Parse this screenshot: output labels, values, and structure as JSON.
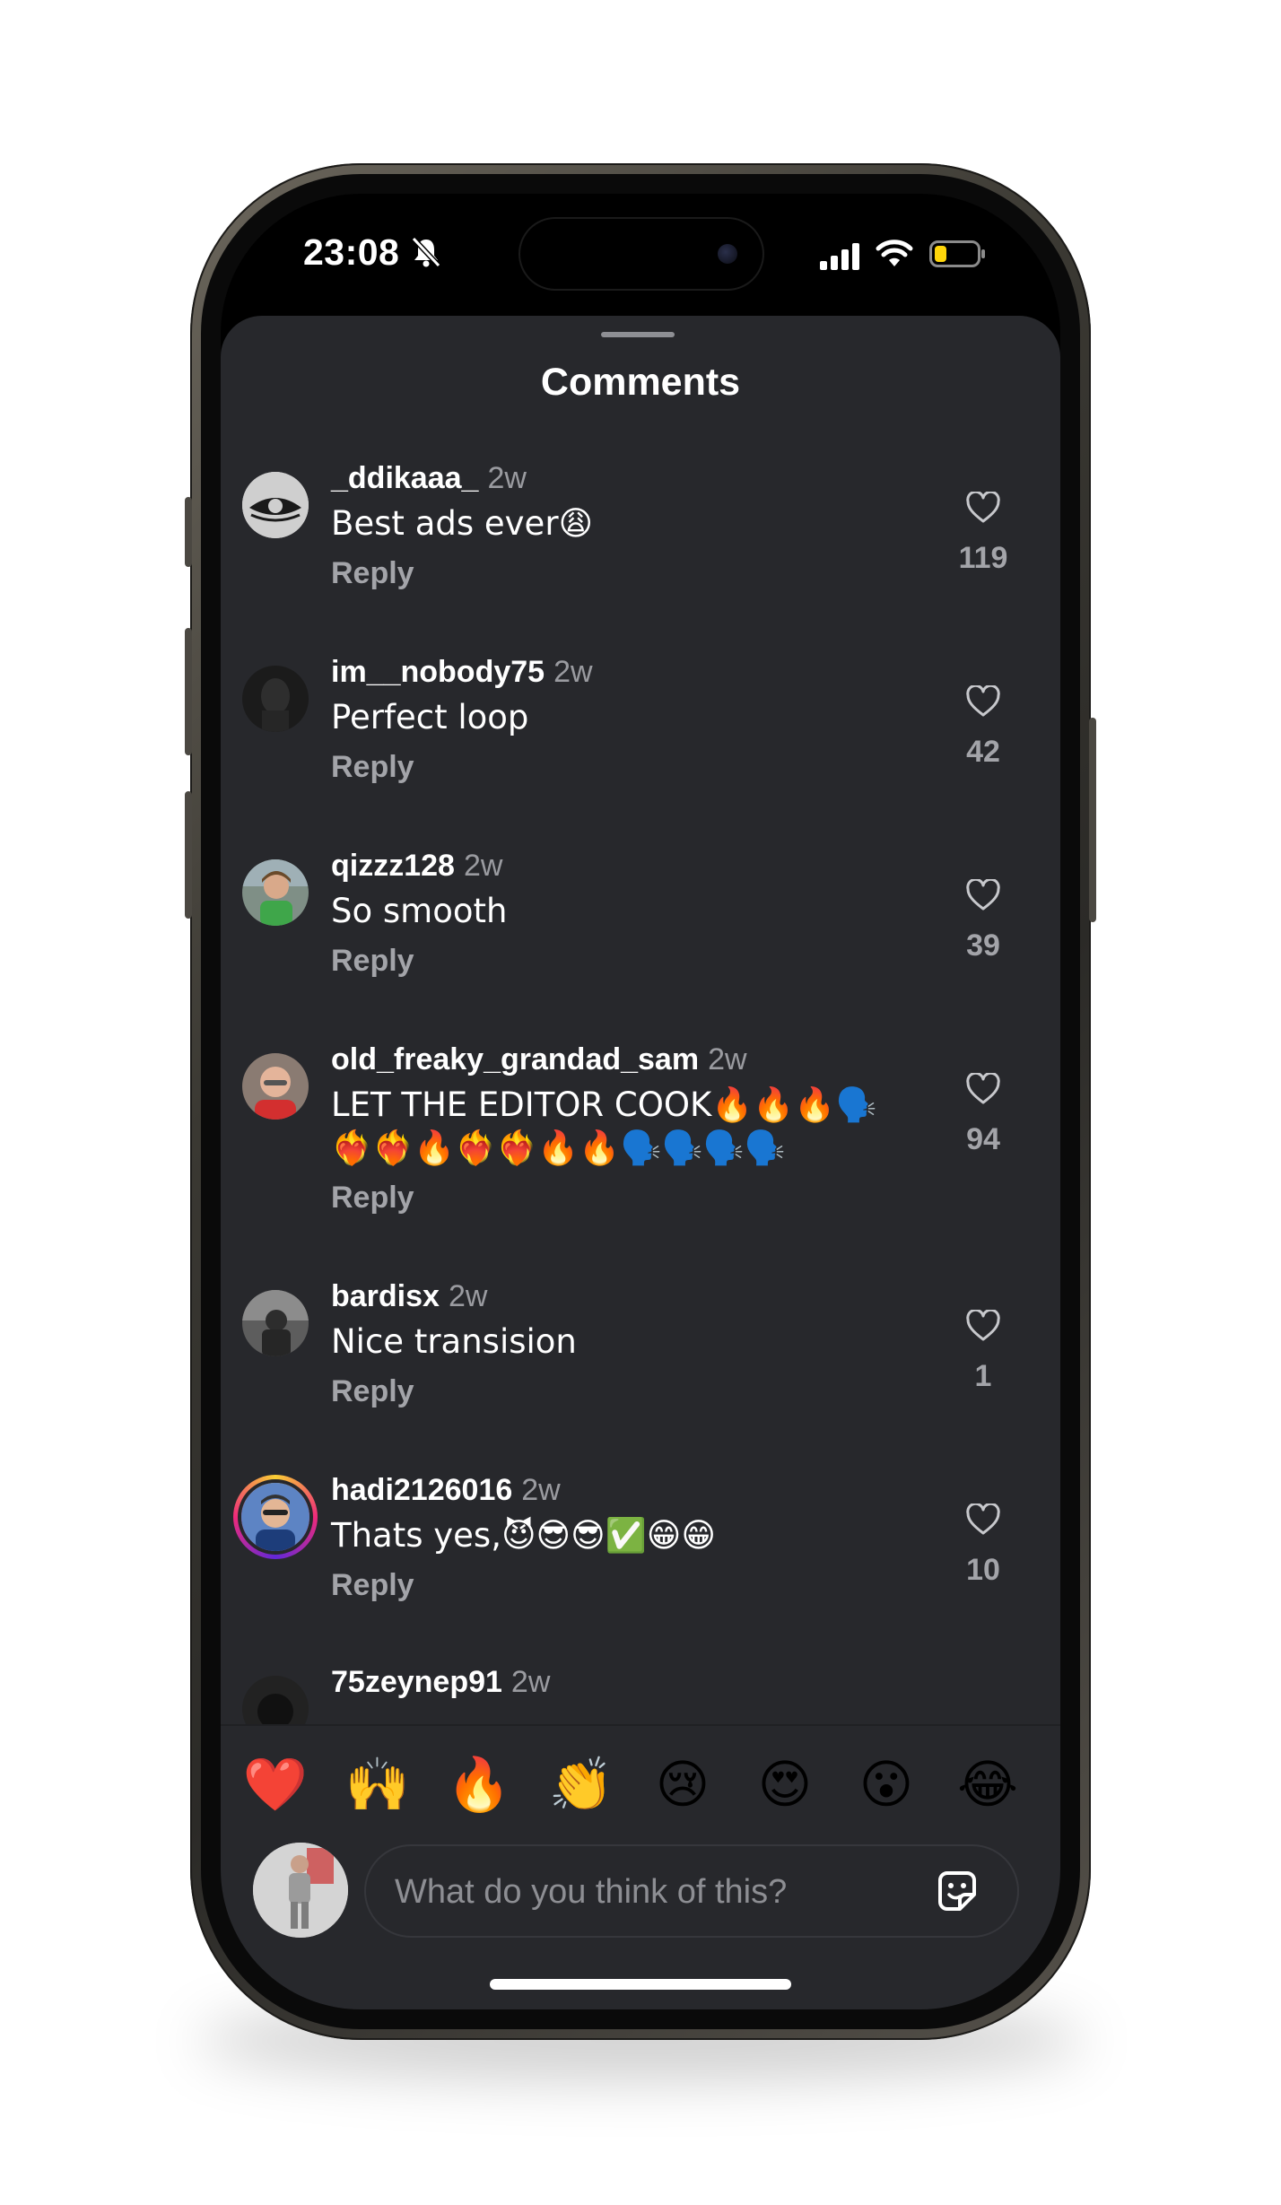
{
  "status_bar": {
    "time": "23:08",
    "icons": [
      "bell-slash-icon",
      "cellular-signal-icon",
      "wifi-icon",
      "battery-low-icon"
    ],
    "battery_color": "#ffd60a"
  },
  "sheet": {
    "title": "Comments"
  },
  "comments": [
    {
      "username": "_ddikaaa_",
      "time_ago": "2w",
      "text": "Best ads ever😩",
      "reply_label": "Reply",
      "likes": "119"
    },
    {
      "username": "im__nobody75",
      "time_ago": "2w",
      "text": "Perfect loop",
      "reply_label": "Reply",
      "likes": "42"
    },
    {
      "username": "qizzz128",
      "time_ago": "2w",
      "text": "So smooth",
      "reply_label": "Reply",
      "likes": "39"
    },
    {
      "username": "old_freaky_grandad_sam",
      "time_ago": "2w",
      "text": "LET THE EDITOR COOK🔥🔥🔥🗣️❤️‍🔥❤️‍🔥🔥❤️‍🔥❤️‍🔥🔥🔥🗣️🗣️🗣️🗣️",
      "reply_label": "Reply",
      "likes": "94"
    },
    {
      "username": "bardisx",
      "time_ago": "2w",
      "text": "Nice transision",
      "reply_label": "Reply",
      "likes": "1"
    },
    {
      "username": "hadi2126016",
      "time_ago": "2w",
      "text": "Thats yes,😈😎😎✅😁😁",
      "reply_label": "Reply",
      "likes": "10"
    },
    {
      "username": "75zeynep91",
      "time_ago": "2w",
      "text": "",
      "reply_label": "",
      "likes": ""
    }
  ],
  "quick_reactions": [
    "❤️",
    "🙌",
    "🔥",
    "👏",
    "😢",
    "😍",
    "😮",
    "😂"
  ],
  "composer": {
    "placeholder": "What do you think of this?"
  },
  "colors": {
    "sheet_bg": "#27282c",
    "text_primary": "#ffffff",
    "text_secondary": "#a3a4a9",
    "story_ring": "#ee2a7b"
  }
}
